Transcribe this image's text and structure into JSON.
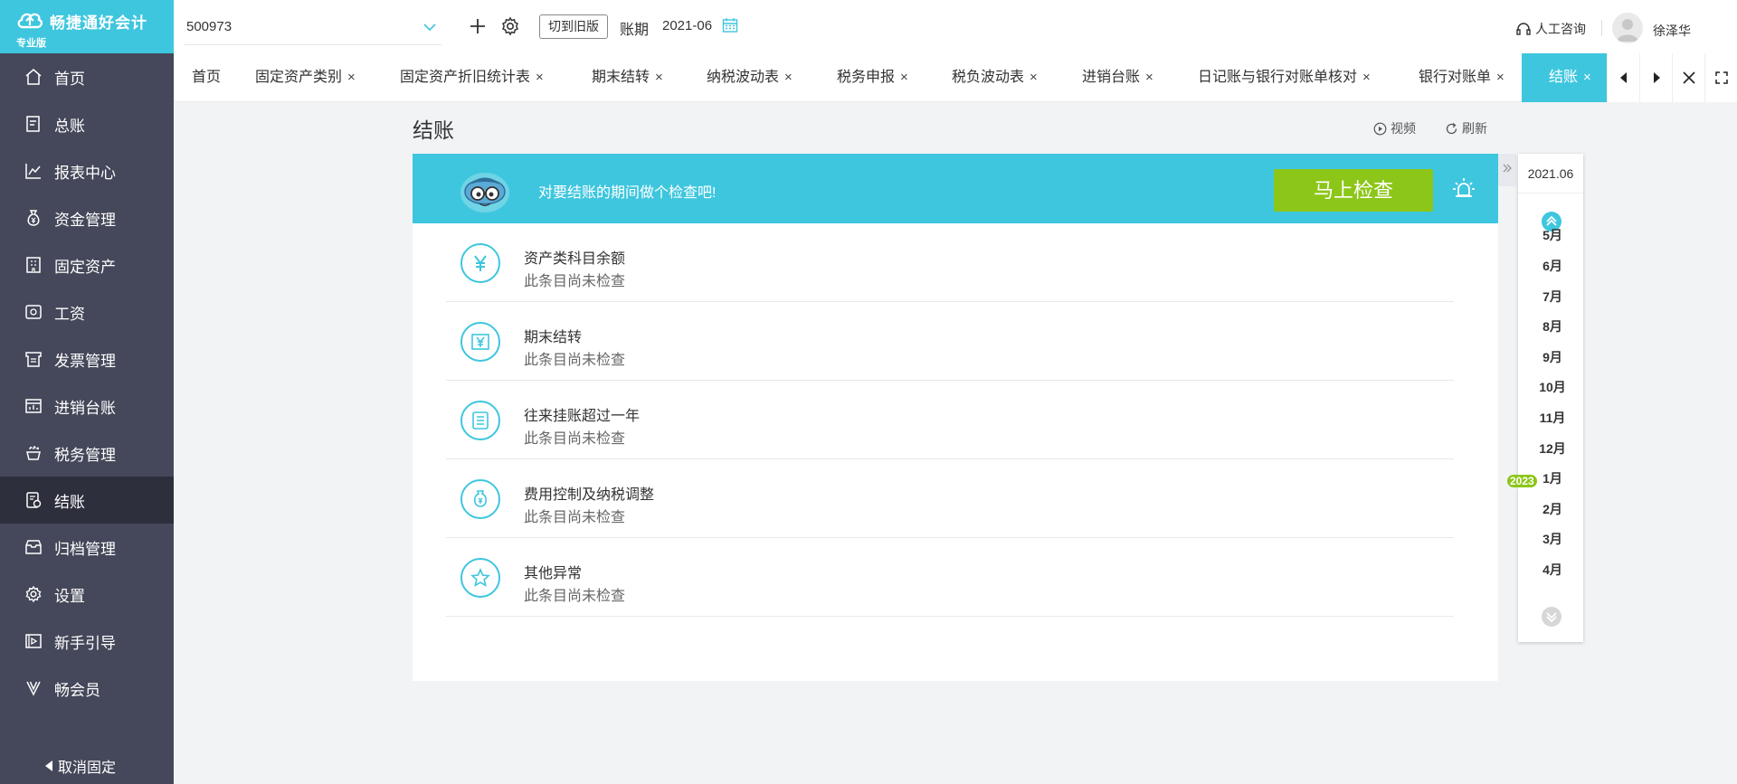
{
  "app": {
    "brand": "畅捷通好会计",
    "edition": "专业版"
  },
  "topbar": {
    "company": "500973",
    "switch_old_label": "切到旧版",
    "period_label": "账期",
    "period_value": "2021-06",
    "consult_label": "人工咨询",
    "username": "徐泽华"
  },
  "sidebar": {
    "items": [
      {
        "label": "首页",
        "icon": "home-icon"
      },
      {
        "label": "总账",
        "icon": "ledger-icon"
      },
      {
        "label": "报表中心",
        "icon": "report-icon"
      },
      {
        "label": "资金管理",
        "icon": "money-bag-icon"
      },
      {
        "label": "固定资产",
        "icon": "building-icon"
      },
      {
        "label": "工资",
        "icon": "salary-icon"
      },
      {
        "label": "发票管理",
        "icon": "invoice-icon"
      },
      {
        "label": "进销台账",
        "icon": "inventory-icon"
      },
      {
        "label": "税务管理",
        "icon": "tax-icon"
      },
      {
        "label": "结账",
        "icon": "closing-icon"
      },
      {
        "label": "归档管理",
        "icon": "archive-icon"
      },
      {
        "label": "设置",
        "icon": "gear-icon"
      },
      {
        "label": "新手引导",
        "icon": "guide-icon"
      },
      {
        "label": "畅会员",
        "icon": "vip-icon"
      }
    ],
    "active_index": 9,
    "unpin_label": "取消固定"
  },
  "tabs": [
    {
      "label": "首页",
      "closable": false
    },
    {
      "label": "固定资产类别",
      "closable": true
    },
    {
      "label": "固定资产折旧统计表",
      "closable": true
    },
    {
      "label": "期末结转",
      "closable": true
    },
    {
      "label": "纳税波动表",
      "closable": true
    },
    {
      "label": "税务申报",
      "closable": true
    },
    {
      "label": "税负波动表",
      "closable": true
    },
    {
      "label": "进销台账",
      "closable": true
    },
    {
      "label": "日记账与银行对账单核对",
      "closable": true
    },
    {
      "label": "银行对账单",
      "closable": true
    },
    {
      "label": "结账",
      "closable": true,
      "active": true
    }
  ],
  "close_glyph": "×",
  "page": {
    "title": "结账",
    "video_label": "视频",
    "refresh_label": "刷新"
  },
  "banner": {
    "text": "对要结账的期间做个检查吧!",
    "check_button": "马上检查"
  },
  "checks": [
    {
      "name": "资产类科目余额",
      "status": "此条目尚未检查",
      "icon": "yen-icon"
    },
    {
      "name": "期末结转",
      "status": "此条目尚未检查",
      "icon": "yen-document-icon"
    },
    {
      "name": "往来挂账超过一年",
      "status": "此条目尚未检查",
      "icon": "list-document-icon"
    },
    {
      "name": "费用控制及纳税调整",
      "status": "此条目尚未检查",
      "icon": "expense-icon"
    },
    {
      "name": "其他异常",
      "status": "此条目尚未检查",
      "icon": "star-icon"
    }
  ],
  "months_panel": {
    "current": "2021.06",
    "year_badge": "2023",
    "months": [
      "5月",
      "6月",
      "7月",
      "8月",
      "9月",
      "10月",
      "11月",
      "12月",
      "1月",
      "2月",
      "3月",
      "4月"
    ]
  },
  "colors": {
    "accent": "#3ec6de",
    "sidebar_bg": "#45485a",
    "sidebar_active": "#2d2f3d",
    "check_button": "#8cc618"
  }
}
